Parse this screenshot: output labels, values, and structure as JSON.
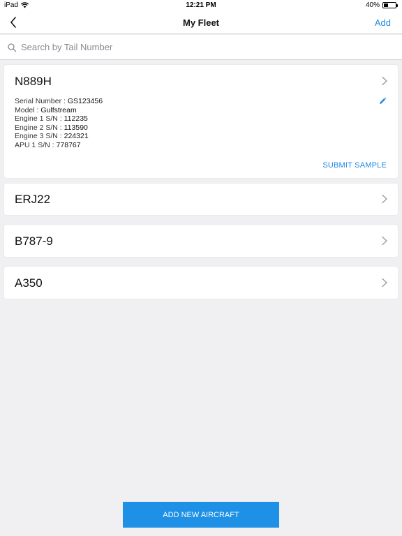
{
  "status_bar": {
    "device": "iPad",
    "time": "12:21 PM",
    "battery_text": "40%",
    "battery_level": 0.4
  },
  "nav": {
    "title": "My Fleet",
    "add_label": "Add"
  },
  "search": {
    "placeholder": "Search by Tail Number"
  },
  "aircraft": [
    {
      "tail": "N889H",
      "expanded": true,
      "details": [
        {
          "label": "Serial Number : ",
          "value": "GS123456"
        },
        {
          "label": "Model : ",
          "value": "Gulfstream"
        },
        {
          "label": "Engine 1 S/N : ",
          "value": "112235"
        },
        {
          "label": "Engine 2 S/N : ",
          "value": "113590"
        },
        {
          "label": "Engine 3 S/N : ",
          "value": "224321"
        },
        {
          "label": "APU 1 S/N : ",
          "value": "778767"
        }
      ],
      "action_label": "SUBMIT SAMPLE"
    },
    {
      "tail": "ERJ22",
      "expanded": false
    },
    {
      "tail": "B787-9",
      "expanded": false
    },
    {
      "tail": "A350",
      "expanded": false
    }
  ],
  "footer": {
    "add_aircraft_label": "ADD NEW AIRCRAFT"
  },
  "colors": {
    "accent": "#1e88e5",
    "button": "#1e90e6"
  },
  "icons": {
    "back": "chevron-left-icon",
    "search": "magnifier-icon",
    "row": "chevron-right-icon",
    "edit": "pencil-icon",
    "wifi": "wifi-icon",
    "battery": "battery-icon"
  }
}
